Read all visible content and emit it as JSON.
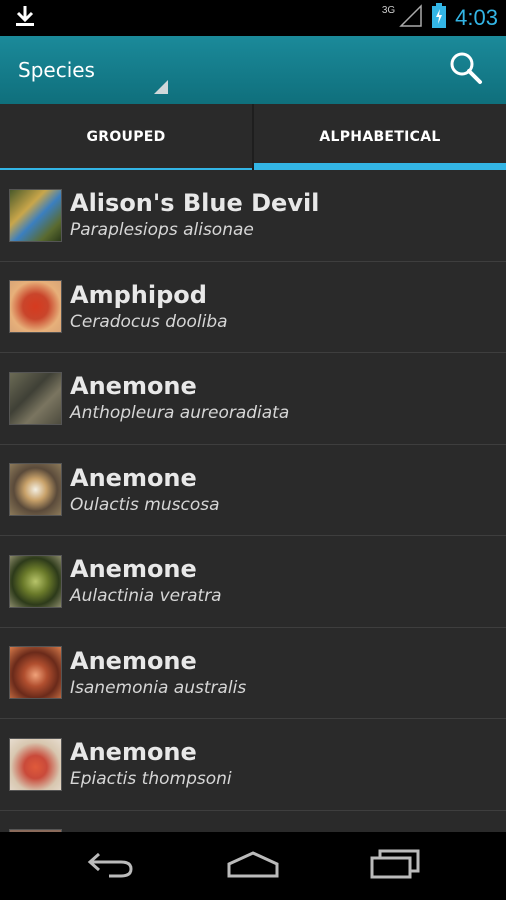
{
  "status_bar": {
    "network": "3G",
    "time": "4:03"
  },
  "action_bar": {
    "title": "Species"
  },
  "tabs": [
    {
      "label": "GROUPED",
      "selected": false
    },
    {
      "label": "ALPHABETICAL",
      "selected": true
    }
  ],
  "species": [
    {
      "common": "Alison's Blue Devil",
      "scientific": "Paraplesiops alisonae",
      "thumb": "linear-gradient(135deg,#4a5a2a 0%,#c9a64a 35%,#3b7fbf 55%,#5a6a2f 80%,#2b3a1a 100%)"
    },
    {
      "common": "Amphipod",
      "scientific": "Ceradocus dooliba",
      "thumb": "radial-gradient(circle at 50% 50%,#d63a1f 0%,#c9452b 35%,#e7b07a 70%,#d9a577 100%)"
    },
    {
      "common": "Anemone",
      "scientific": "Anthopleura aureoradiata",
      "thumb": "linear-gradient(135deg,#6b6a55 0%,#3f4036 40%,#7a7560 65%,#4d4b3e 100%)"
    },
    {
      "common": "Anemone",
      "scientific": "Oulactis muscosa",
      "thumb": "radial-gradient(circle at 50% 50%,#f3efe3 0%,#c9a26a 30%,#5a4a3a 60%,#8c7a5a 100%)"
    },
    {
      "common": "Anemone",
      "scientific": "Aulactinia veratra",
      "thumb": "radial-gradient(circle at 50% 50%,#b7c46a 0%,#6a7a2a 35%,#2d3a1a 65%,#8a8a6a 100%)"
    },
    {
      "common": "Anemone",
      "scientific": "Isanemonia australis",
      "thumb": "radial-gradient(circle at 50% 55%,#f0a27a 0%,#b14f2f 30%,#6a2a1a 60%,#d67a4a 100%)"
    },
    {
      "common": "Anemone",
      "scientific": "Epiactis thompsoni",
      "thumb": "radial-gradient(circle at 50% 55%,#e05a3a 0%,#c94a3a 30%,#d8c7b0 65%,#e7ddd0 100%)"
    }
  ]
}
